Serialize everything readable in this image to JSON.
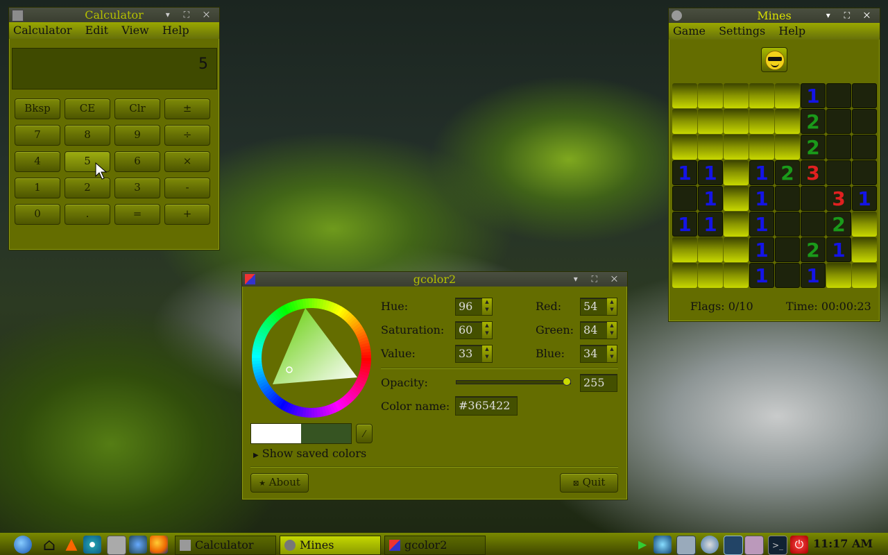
{
  "calculator": {
    "title": "Calculator",
    "menu": [
      "Calculator",
      "Edit",
      "View",
      "Help"
    ],
    "display": "5",
    "buttons": [
      "Bksp",
      "CE",
      "Clr",
      "±",
      "7",
      "8",
      "9",
      "÷",
      "4",
      "5",
      "6",
      "×",
      "1",
      "2",
      "3",
      "-",
      "0",
      ".",
      "=",
      "+"
    ]
  },
  "mines": {
    "title": "Mines",
    "menu": [
      "Game",
      "Settings",
      "Help"
    ],
    "grid": [
      [
        "",
        "",
        "",
        "",
        "",
        "1",
        "o",
        "o"
      ],
      [
        "",
        "",
        "",
        "",
        "",
        "2",
        "o",
        "o"
      ],
      [
        "",
        "",
        "",
        "",
        "",
        "2",
        "o",
        "o"
      ],
      [
        "1",
        "1",
        "",
        "1",
        "2",
        "3",
        "o",
        "o"
      ],
      [
        "o",
        "1",
        "",
        "1",
        "o",
        "o",
        "3",
        "1"
      ],
      [
        "1",
        "1",
        "",
        "1",
        "o",
        "o",
        "2",
        ""
      ],
      [
        "",
        "",
        "",
        "1",
        "o",
        "2",
        "1",
        ""
      ],
      [
        "",
        "",
        "",
        "1",
        "o",
        "1",
        "",
        ""
      ]
    ],
    "number_colors": {
      "1": "#1414e6",
      "2": "#1a9a1a",
      "3": "#e02020"
    },
    "flags": "Flags: 0/10",
    "time": "Time: 00:00:23"
  },
  "gcolor": {
    "title": "gcolor2",
    "hue_label": "Hue:",
    "hue": "96",
    "sat_label": "Saturation:",
    "sat": "60",
    "val_label": "Value:",
    "val": "33",
    "red_label": "Red:",
    "red": "54",
    "green_label": "Green:",
    "green": "84",
    "blue_label": "Blue:",
    "blue": "34",
    "opacity_label": "Opacity:",
    "opacity": "255",
    "opacity_level": 1.0,
    "colorname_label": "Color name:",
    "colorname": "#365422",
    "current_color": "#365422",
    "show_saved": "Show saved colors",
    "about": "About",
    "quit": "Quit"
  },
  "taskbar": {
    "tasks": [
      "Calculator",
      "Mines",
      "gcolor2"
    ],
    "clock": "11:17 AM"
  }
}
